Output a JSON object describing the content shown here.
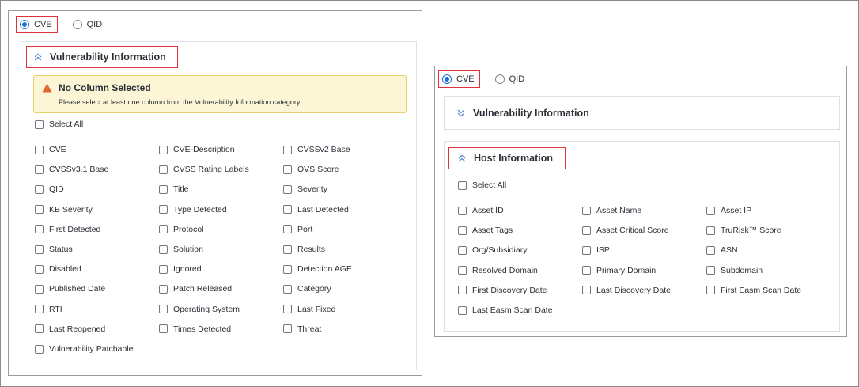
{
  "left": {
    "radio_options": [
      {
        "label": "CVE",
        "selected": true
      },
      {
        "label": "QID",
        "selected": false
      }
    ],
    "section_title": "Vulnerability Information",
    "alert": {
      "title": "No Column Selected",
      "message": "Please select at least one column from the Vulnerability Information category."
    },
    "select_all": "Select All",
    "columns": [
      "CVE",
      "CVE-Description",
      "CVSSv2 Base",
      "CVSSv3.1 Base",
      "CVSS Rating Labels",
      "QVS Score",
      "QID",
      "Title",
      "Severity",
      "KB Severity",
      "Type Detected",
      "Last Detected",
      "First Detected",
      "Protocol",
      "Port",
      "Status",
      "Solution",
      "Results",
      "Disabled",
      "Ignored",
      "Detection AGE",
      "Published Date",
      "Patch Released",
      "Category",
      "RTI",
      "Operating System",
      "Last Fixed",
      "Last Reopened",
      "Times Detected",
      "Threat",
      "Vulnerability Patchable"
    ]
  },
  "right": {
    "radio_options": [
      {
        "label": "CVE",
        "selected": true
      },
      {
        "label": "QID",
        "selected": false
      }
    ],
    "collapsed_section_title": "Vulnerability Information",
    "section_title": "Host Information",
    "select_all": "Select All",
    "columns": [
      "Asset ID",
      "Asset Name",
      "Asset IP",
      "Asset Tags",
      "Asset Critical Score",
      "TruRisk™ Score",
      "Org/Subsidiary",
      "ISP",
      "ASN",
      "Resolved Domain",
      "Primary Domain",
      "Subdomain",
      "First Discovery Date",
      "Last Discovery Date",
      "First Easm Scan Date",
      "Last Easm Scan Date"
    ]
  },
  "colors": {
    "highlight": "#e0313b",
    "radio_accent": "#1d6fd6",
    "chevron": "#5b8fd6",
    "alert_bg": "#fcf5d6",
    "alert_border": "#e8cf6b",
    "warning_icon": "#e0622a"
  },
  "icons": {
    "collapse": "chevron-double-up-icon",
    "expand": "chevron-double-down-icon",
    "warning": "warning-triangle-icon"
  }
}
